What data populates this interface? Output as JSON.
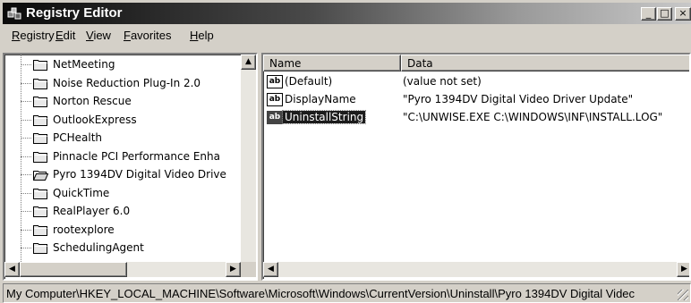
{
  "window": {
    "title": "Registry Editor"
  },
  "title_buttons": {
    "minimize": "_",
    "maximize": "□",
    "close": "×"
  },
  "menubar": [
    {
      "label": "Registry",
      "accel": "R"
    },
    {
      "label": "Edit",
      "accel": "E"
    },
    {
      "label": "View",
      "accel": "V"
    },
    {
      "label": "Favorites",
      "accel": "F"
    },
    {
      "label": "Help",
      "accel": "H"
    }
  ],
  "tree": {
    "items": [
      {
        "label": "NetMeeting",
        "open": false
      },
      {
        "label": "Noise Reduction Plug-In 2.0",
        "open": false
      },
      {
        "label": "Norton Rescue",
        "open": false
      },
      {
        "label": "OutlookExpress",
        "open": false
      },
      {
        "label": "PCHealth",
        "open": false
      },
      {
        "label": "Pinnacle PCI Performance Enha",
        "open": false
      },
      {
        "label": "Pyro 1394DV Digital Video Drive",
        "open": true
      },
      {
        "label": "QuickTime",
        "open": false
      },
      {
        "label": "RealPlayer 6.0",
        "open": false
      },
      {
        "label": "rootexplore",
        "open": false
      },
      {
        "label": "SchedulingAgent",
        "open": false
      }
    ]
  },
  "values_list": {
    "headers": {
      "name": "Name",
      "data": "Data"
    },
    "rows": [
      {
        "icon": "ab",
        "name": "(Default)",
        "data": "(value not set)",
        "selected": false
      },
      {
        "icon": "ab",
        "name": "DisplayName",
        "data": "\"Pyro 1394DV Digital Video Driver Update\"",
        "selected": false
      },
      {
        "icon": "ab",
        "name": "UninstallString",
        "data": "\"C:\\UNWISE.EXE C:\\WINDOWS\\INF\\INSTALL.LOG\"",
        "selected": true
      }
    ]
  },
  "scroll_arrows": {
    "up": "▲",
    "left": "◀",
    "right": "▶"
  },
  "statusbar": {
    "path": "My Computer\\HKEY_LOCAL_MACHINE\\Software\\Microsoft\\Windows\\CurrentVersion\\Uninstall\\Pyro 1394DV Digital Videc"
  }
}
